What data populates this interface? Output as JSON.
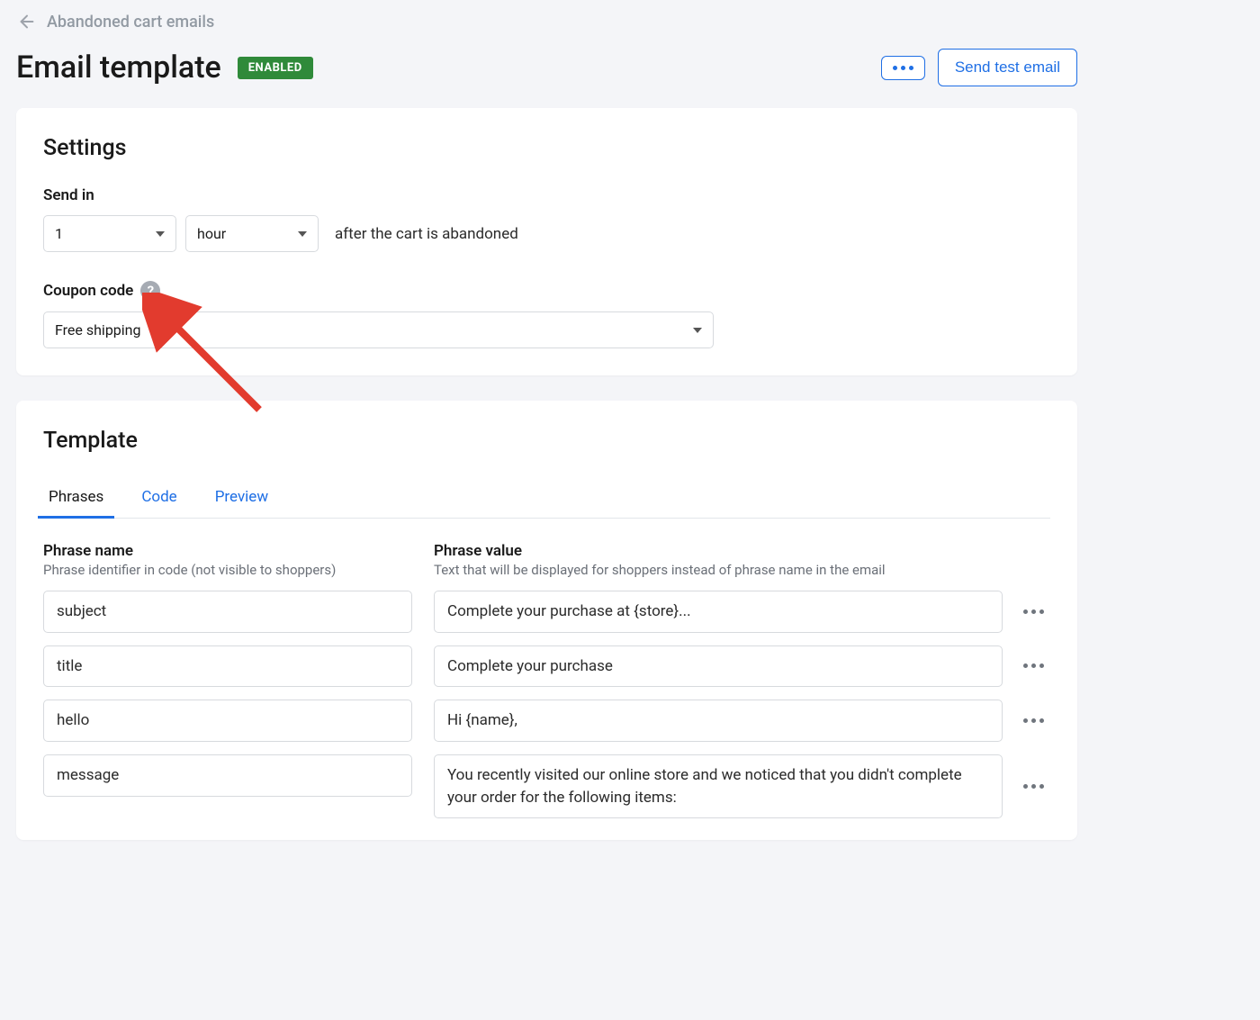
{
  "breadcrumb": {
    "label": "Abandoned cart emails"
  },
  "header": {
    "title": "Email template",
    "status_badge": "ENABLED",
    "send_test_label": "Send test email"
  },
  "settings": {
    "section_title": "Settings",
    "send_in_label": "Send in",
    "send_in_value": "1",
    "send_in_unit": "hour",
    "after_text": "after the cart is abandoned",
    "coupon_label": "Coupon code",
    "coupon_value": "Free shipping"
  },
  "template": {
    "section_title": "Template",
    "tabs": [
      {
        "label": "Phrases",
        "active": true
      },
      {
        "label": "Code",
        "active": false
      },
      {
        "label": "Preview",
        "active": false
      }
    ],
    "columns": {
      "name_header": "Phrase name",
      "name_sub": "Phrase identifier in code (not visible to shoppers)",
      "value_header": "Phrase value",
      "value_sub": "Text that will be displayed for shoppers instead of phrase name in the email"
    },
    "phrases": [
      {
        "name": "subject",
        "value": "Complete your purchase at {store}..."
      },
      {
        "name": "title",
        "value": "Complete your purchase"
      },
      {
        "name": "hello",
        "value": "Hi {name},"
      },
      {
        "name": "message",
        "value": "You recently visited our online store and we noticed that you didn't complete your order for the following items:"
      }
    ]
  }
}
